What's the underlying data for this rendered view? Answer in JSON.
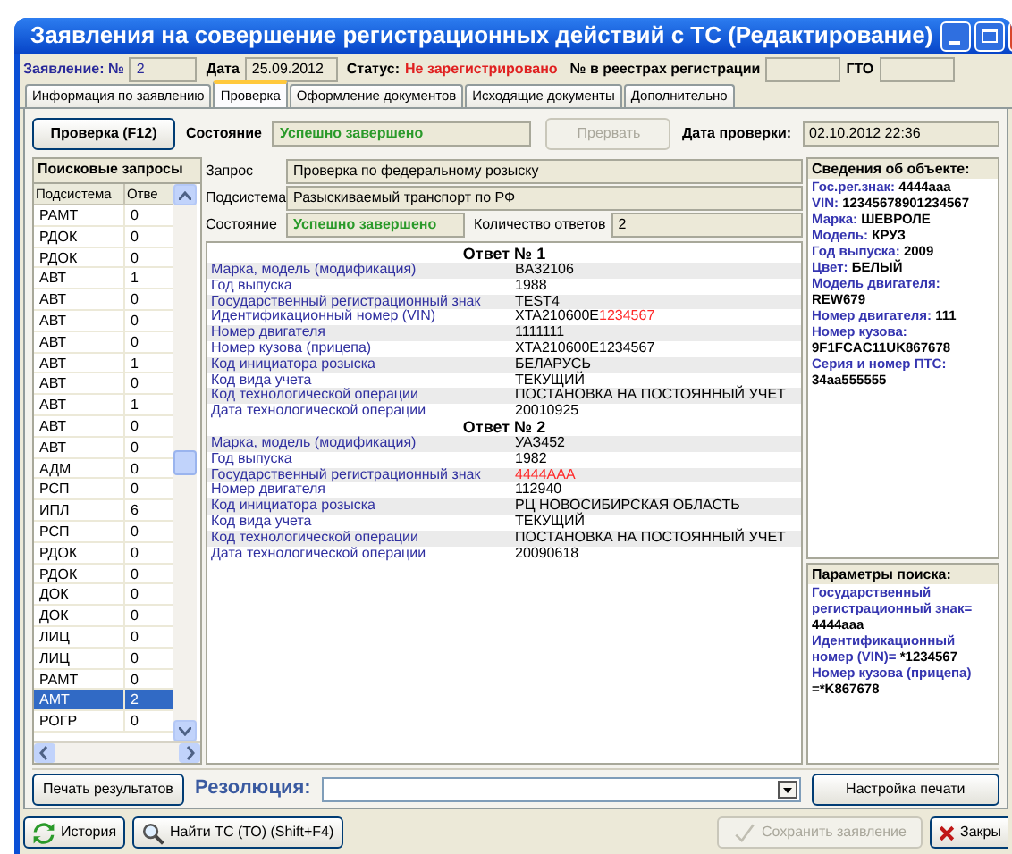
{
  "window": {
    "title": "Заявления на совершение регистрационных действий с ТС (Редактирование)"
  },
  "header": {
    "number_label": "Заявление: №",
    "number": "2",
    "date_label": "Дата",
    "date": "25.09.2012",
    "status_label": "Статус:",
    "status": "Не зарегистрировано",
    "registry_label": "№ в реестрах регистрации",
    "gto_label": "ГТО"
  },
  "tabs": [
    {
      "label": "Информация по заявлению",
      "selected": false
    },
    {
      "label": "Проверка",
      "selected": true
    },
    {
      "label": "Оформление документов",
      "selected": false
    },
    {
      "label": "Исходящие документы",
      "selected": false
    },
    {
      "label": "Дополнительно",
      "selected": false
    }
  ],
  "check_bar": {
    "button": "Проверка (F12)",
    "state_label": "Состояние",
    "state": "Успешно завершено",
    "abort_button": {
      "label": "Прервать",
      "disabled": true
    },
    "date_label": "Дата проверки:",
    "date": "02.10.2012 22:36"
  },
  "queries": {
    "title": "Поисковые запросы",
    "columns": [
      "Подсистема",
      "Отве"
    ],
    "rows": [
      {
        "subsystem": "РАМТ",
        "answers": "0",
        "selected": false
      },
      {
        "subsystem": "РДОК",
        "answers": "0",
        "selected": false
      },
      {
        "subsystem": "РДОК",
        "answers": "0",
        "selected": false
      },
      {
        "subsystem": "АВТ",
        "answers": "1",
        "selected": false
      },
      {
        "subsystem": "АВТ",
        "answers": "0",
        "selected": false
      },
      {
        "subsystem": "АВТ",
        "answers": "0",
        "selected": false
      },
      {
        "subsystem": "АВТ",
        "answers": "0",
        "selected": false
      },
      {
        "subsystem": "АВТ",
        "answers": "1",
        "selected": false
      },
      {
        "subsystem": "АВТ",
        "answers": "0",
        "selected": false
      },
      {
        "subsystem": "АВТ",
        "answers": "1",
        "selected": false
      },
      {
        "subsystem": "АВТ",
        "answers": "0",
        "selected": false
      },
      {
        "subsystem": "АВТ",
        "answers": "0",
        "selected": false
      },
      {
        "subsystem": "АДМ",
        "answers": "0",
        "selected": false
      },
      {
        "subsystem": "РСП",
        "answers": "0",
        "selected": false
      },
      {
        "subsystem": "ИПЛ",
        "answers": "6",
        "selected": false
      },
      {
        "subsystem": "РСП",
        "answers": "0",
        "selected": false
      },
      {
        "subsystem": "РДОК",
        "answers": "0",
        "selected": false
      },
      {
        "subsystem": "РДОК",
        "answers": "0",
        "selected": false
      },
      {
        "subsystem": "ДОК",
        "answers": "0",
        "selected": false
      },
      {
        "subsystem": "ДОК",
        "answers": "0",
        "selected": false
      },
      {
        "subsystem": "ЛИЦ",
        "answers": "0",
        "selected": false
      },
      {
        "subsystem": "ЛИЦ",
        "answers": "0",
        "selected": false
      },
      {
        "subsystem": "РАМТ",
        "answers": "0",
        "selected": false
      },
      {
        "subsystem": "АМТ",
        "answers": "2",
        "selected": true
      },
      {
        "subsystem": "РОГР",
        "answers": "0",
        "selected": false
      }
    ]
  },
  "request": {
    "query_label": "Запрос",
    "query": "Проверка по федеральному розыску",
    "subsystem_label": "Подсистема",
    "subsystem": "Разыскиваемый транспорт по РФ",
    "state_label": "Состояние",
    "state": "Успешно завершено",
    "count_label": "Количество ответов",
    "count": "2"
  },
  "answers": [
    {
      "title": "Ответ № 1",
      "fields": [
        {
          "label": "Марка, модель (модификация)",
          "value": [
            {
              "text": "BA32106",
              "highlight": false
            }
          ]
        },
        {
          "label": "Год выпуска",
          "value": [
            {
              "text": "1988",
              "highlight": false
            }
          ]
        },
        {
          "label": "Государственный регистрационный знак",
          "value": [
            {
              "text": "TEST4",
              "highlight": false
            }
          ]
        },
        {
          "label": "Идентификационный номер (VIN)",
          "value": [
            {
              "text": "XTA210600E",
              "highlight": false
            },
            {
              "text": "1234567",
              "highlight": true
            }
          ]
        },
        {
          "label": "Номер двигателя",
          "value": [
            {
              "text": "1111111",
              "highlight": false
            }
          ]
        },
        {
          "label": "Номер кузова (прицепа)",
          "value": [
            {
              "text": "XTA210600E1234567",
              "highlight": false
            }
          ]
        },
        {
          "label": "Код инициатора розыска",
          "value": [
            {
              "text": "БЕЛАРУСЬ",
              "highlight": false
            }
          ]
        },
        {
          "label": "Код вида учета",
          "value": [
            {
              "text": "ТЕКУЩИЙ",
              "highlight": false
            }
          ]
        },
        {
          "label": "Код технологической операции",
          "value": [
            {
              "text": "ПОСТАНОВКА НА ПОСТОЯННЫЙ УЧЕТ",
              "highlight": false
            }
          ]
        },
        {
          "label": "Дата технологической операции",
          "value": [
            {
              "text": "20010925",
              "highlight": false
            }
          ]
        }
      ]
    },
    {
      "title": "Ответ № 2",
      "fields": [
        {
          "label": "Марка, модель (модификация)",
          "value": [
            {
              "text": "УАЗ452",
              "highlight": false
            }
          ]
        },
        {
          "label": "Год выпуска",
          "value": [
            {
              "text": "1982",
              "highlight": false
            }
          ]
        },
        {
          "label": "Государственный регистрационный знак",
          "value": [
            {
              "text": "4444AAA",
              "highlight": true
            }
          ]
        },
        {
          "label": "Номер двигателя",
          "value": [
            {
              "text": "112940",
              "highlight": false
            }
          ]
        },
        {
          "label": "Код инициатора розыска",
          "value": [
            {
              "text": "РЦ НОВОСИБИРСКАЯ ОБЛАСТЬ",
              "highlight": false
            }
          ]
        },
        {
          "label": "Код вида учета",
          "value": [
            {
              "text": "ТЕКУЩИЙ",
              "highlight": false
            }
          ]
        },
        {
          "label": "Код технологической операции",
          "value": [
            {
              "text": "ПОСТАНОВКА НА ПОСТОЯННЫЙ УЧЕТ",
              "highlight": false
            }
          ]
        },
        {
          "label": "Дата технологической операции",
          "value": [
            {
              "text": "20090618",
              "highlight": false
            }
          ]
        }
      ]
    }
  ],
  "object_info": {
    "title": "Сведения об объекте:",
    "items": [
      {
        "label": "Гос.рег.знак:",
        "value": "4444aaa"
      },
      {
        "label": "VIN:",
        "value": "12345678901234567"
      },
      {
        "label": "Марка:",
        "value": "ШЕВРОЛЕ"
      },
      {
        "label": "Модель:",
        "value": "КРУЗ"
      },
      {
        "label": "Год выпуска:",
        "value": "2009"
      },
      {
        "label": "Цвет:",
        "value": "БЕЛЫЙ"
      },
      {
        "label": "Модель двигателя:",
        "value": "REW679"
      },
      {
        "label": "Номер двигателя:",
        "value": "111"
      },
      {
        "label": "Номер кузова:",
        "value": "9F1FCAC11UK867678"
      },
      {
        "label": "Серия и номер ПТС:",
        "value": "34aa555555"
      }
    ]
  },
  "search_params": {
    "title": "Параметры поиска:",
    "items": [
      {
        "label": "Государственный регистрационный знак=",
        "value": "4444aaa"
      },
      {
        "label": "Идентификационный номер (VIN)=",
        "value": "*1234567"
      },
      {
        "label": "Номер кузова (прицепа)",
        "value": "=*K867678"
      }
    ]
  },
  "bottom": {
    "print_button": "Печать результатов",
    "resolution_label": "Резолюция:",
    "settings_button": "Настройка печати"
  },
  "footer": [
    {
      "kind": "history",
      "label": "История",
      "disabled": false
    },
    {
      "kind": "find",
      "label": "Найти ТС (ТО) (Shift+F4)",
      "disabled": false
    },
    {
      "kind": "save",
      "label": "Сохранить заявление",
      "disabled": true
    },
    {
      "kind": "close",
      "label": "Закры",
      "disabled": false
    }
  ]
}
